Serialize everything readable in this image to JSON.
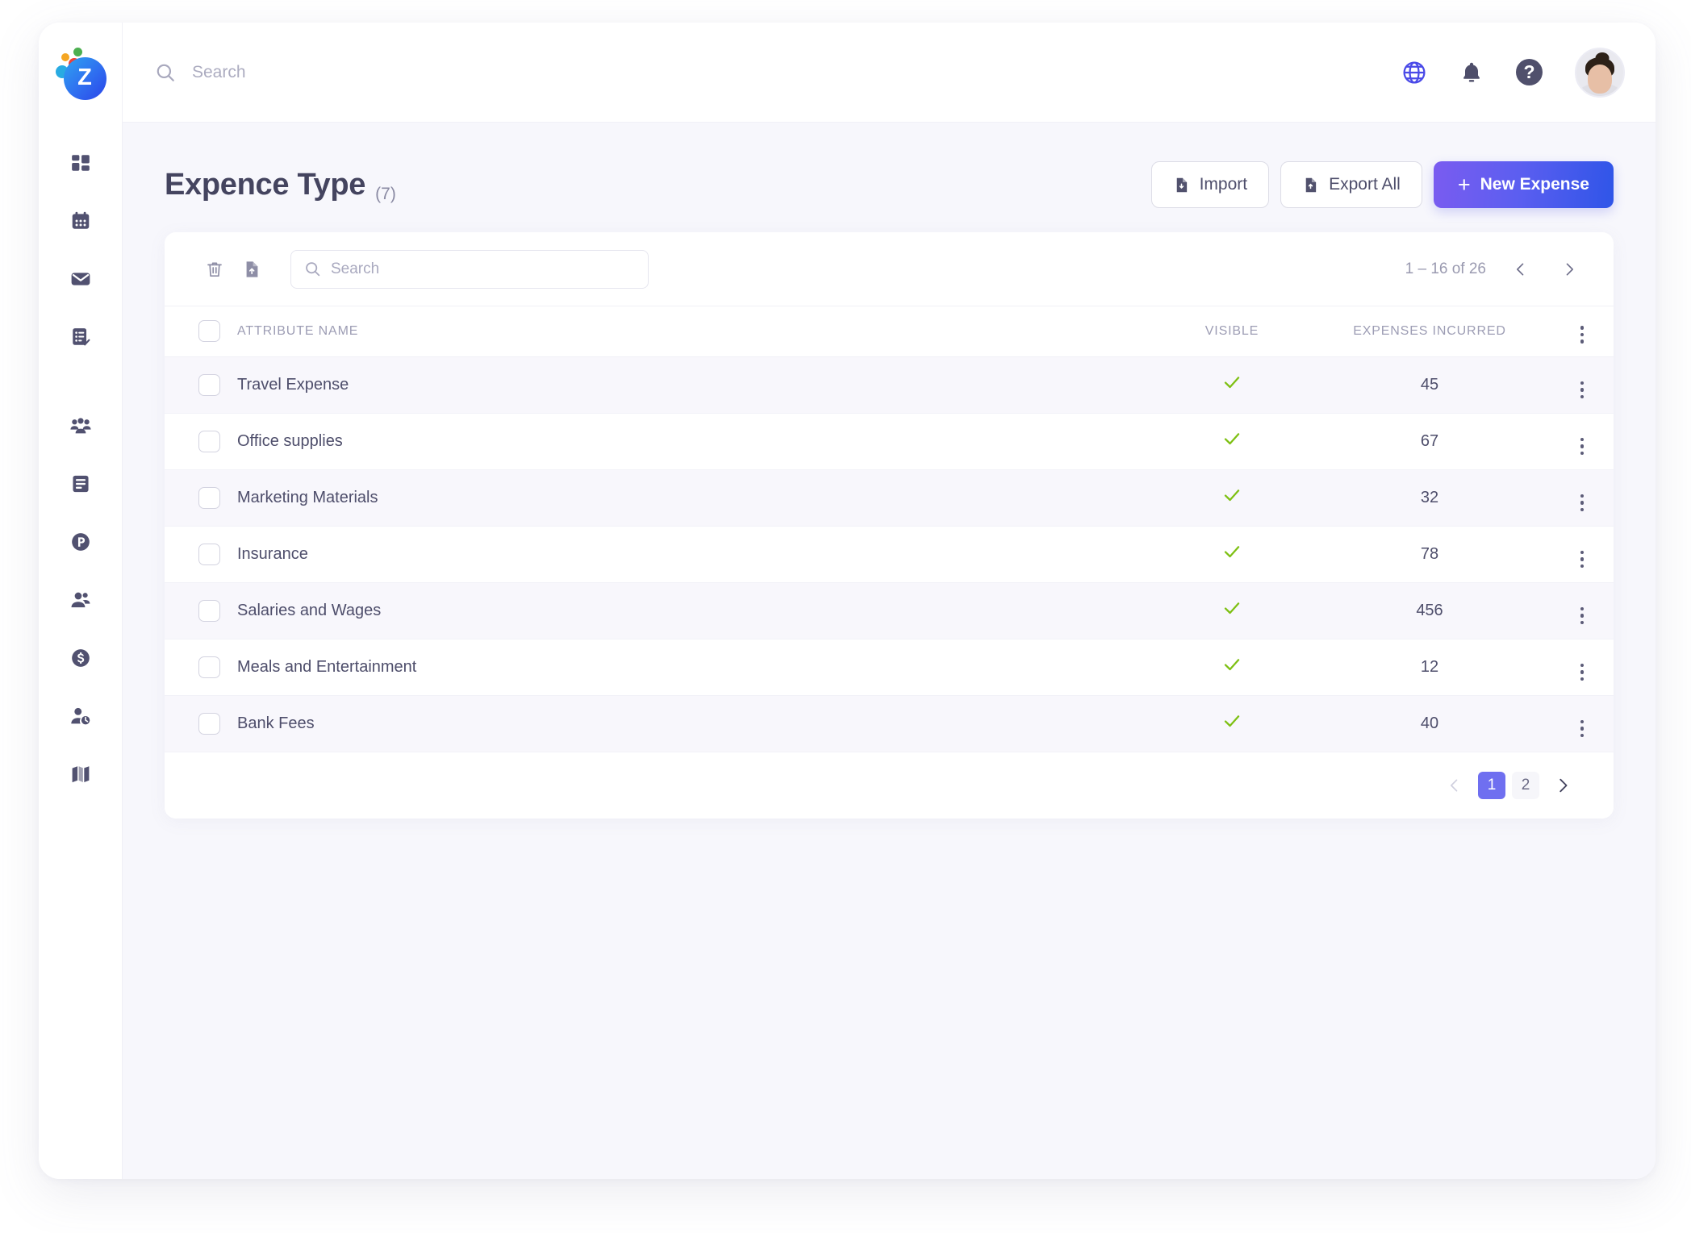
{
  "brand": {
    "logo_letter": "Z",
    "accent": "#2f55e8"
  },
  "sidebar": {
    "items": [
      {
        "icon": "dashboard-grid-icon",
        "name": "dashboard"
      },
      {
        "icon": "calendar-icon",
        "name": "calendar"
      },
      {
        "icon": "mail-icon",
        "name": "mail"
      },
      {
        "icon": "task-check-icon",
        "name": "tasks"
      },
      {
        "icon": "people-group-icon",
        "name": "teams"
      },
      {
        "icon": "document-lines-icon",
        "name": "documents"
      },
      {
        "icon": "p-circle-icon",
        "name": "projects"
      },
      {
        "icon": "contacts-icon",
        "name": "contacts"
      },
      {
        "icon": "dollar-circle-icon",
        "name": "finance"
      },
      {
        "icon": "user-settings-icon",
        "name": "user-settings"
      },
      {
        "icon": "map-icon",
        "name": "map"
      }
    ]
  },
  "topbar": {
    "search_placeholder": "Search",
    "search_value": "",
    "globe_icon": "globe-icon",
    "bell_icon": "bell-icon",
    "help_label": "?",
    "avatar_name": "user-avatar"
  },
  "page": {
    "title": "Expence Type",
    "count": "(7)",
    "import_label": "Import",
    "export_label": "Export All",
    "new_label": "New Expense",
    "new_plus": "+"
  },
  "toolbar": {
    "delete_icon": "trash-icon",
    "export_icon": "file-export-icon",
    "search_placeholder": "Search",
    "search_value": "",
    "range_label": "1 – 16 of 26"
  },
  "table": {
    "headers": {
      "name": "ATTRIBUTE NAME",
      "visible": "VISIBLE",
      "expenses": "EXPENSES INCURRED"
    },
    "check_color": "#7ec013",
    "rows": [
      {
        "name": "Travel Expense",
        "visible": true,
        "expenses": "45"
      },
      {
        "name": "Office supplies",
        "visible": true,
        "expenses": "67"
      },
      {
        "name": "Marketing Materials",
        "visible": true,
        "expenses": "32"
      },
      {
        "name": "Insurance",
        "visible": true,
        "expenses": "78"
      },
      {
        "name": "Salaries and Wages",
        "visible": true,
        "expenses": "456"
      },
      {
        "name": "Meals and Entertainment",
        "visible": true,
        "expenses": "12"
      },
      {
        "name": "Bank Fees",
        "visible": true,
        "expenses": "40"
      }
    ]
  },
  "pagination": {
    "pages": [
      "1",
      "2"
    ],
    "active": "1",
    "active_color": "#6f6ff0"
  }
}
